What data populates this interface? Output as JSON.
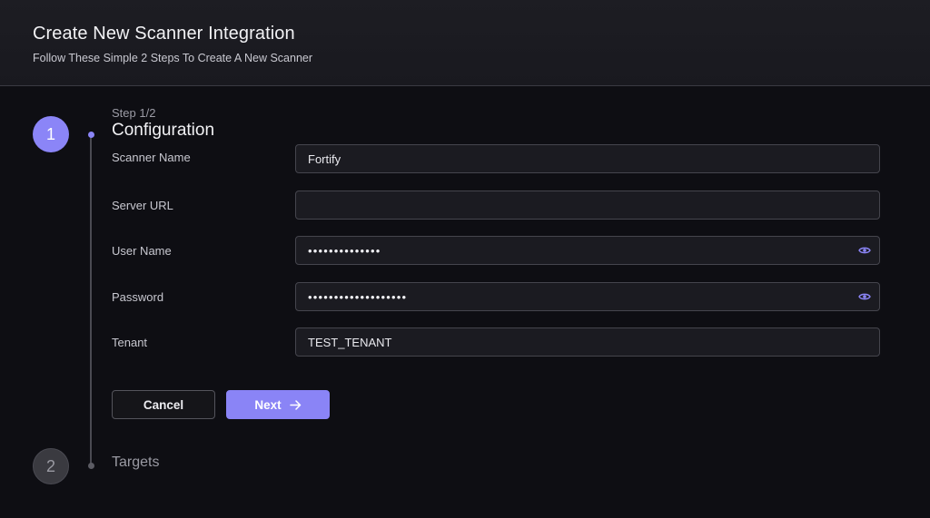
{
  "header": {
    "title": "Create New Scanner Integration",
    "subtitle": "Follow These Simple 2 Steps To Create A New Scanner"
  },
  "steps": [
    {
      "number": "1",
      "label": "Step 1/2",
      "heading": "Configuration",
      "state": "active"
    },
    {
      "number": "2",
      "heading": "Targets",
      "state": "inactive"
    }
  ],
  "form": {
    "scanner_name": {
      "label": "Scanner Name",
      "value": "Fortify"
    },
    "server_url": {
      "label": "Server URL",
      "value": ""
    },
    "user_name": {
      "label": "User Name",
      "value": "••••••••••••••",
      "icon": "eye-icon"
    },
    "password": {
      "label": "Password",
      "value": "•••••••••••••••••••",
      "icon": "eye-icon"
    },
    "tenant": {
      "label": "Tenant",
      "value": "TEST_TENANT"
    }
  },
  "actions": {
    "cancel_label": "Cancel",
    "next_label": "Next",
    "next_icon": "arrow-right-icon"
  },
  "colors": {
    "accent": "#8b85f7",
    "background": "#0e0e13",
    "header_bg": "#1b1b21",
    "input_bg": "#1b1b21",
    "input_border": "#45454d"
  }
}
